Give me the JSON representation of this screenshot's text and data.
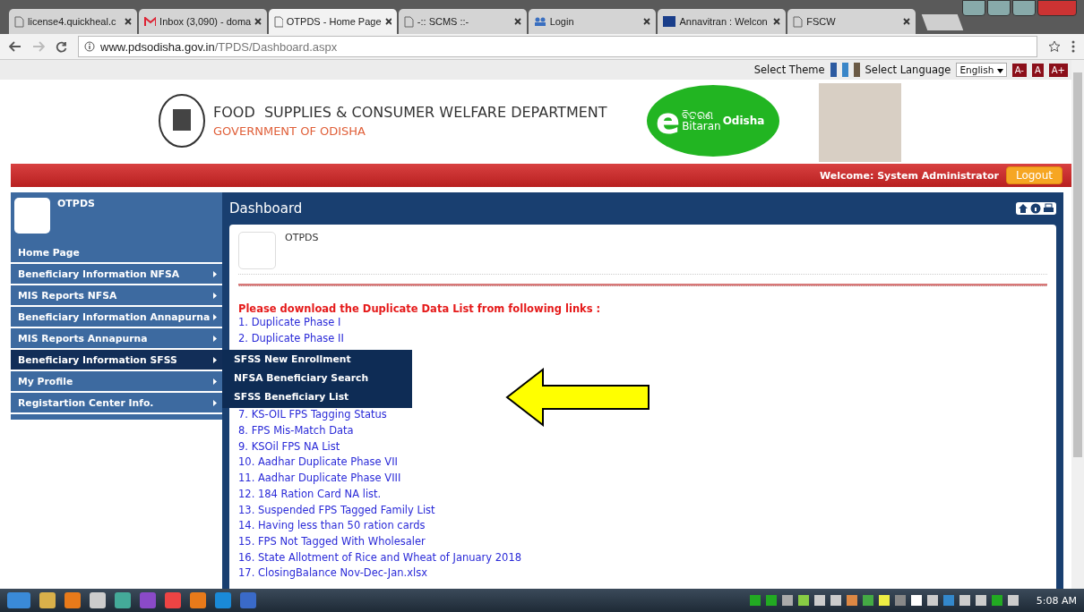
{
  "browser": {
    "tabs": [
      {
        "title": "license4.quickheal.c",
        "selected": false,
        "kind": "page"
      },
      {
        "title": "Inbox (3,090) - doma",
        "selected": false,
        "kind": "mail"
      },
      {
        "title": "OTPDS - Home Page",
        "selected": true,
        "kind": "page"
      },
      {
        "title": "-:: SCMS ::-",
        "selected": false,
        "kind": "page"
      },
      {
        "title": "Login",
        "selected": false,
        "kind": "site"
      },
      {
        "title": "Annavitran : Welcon",
        "selected": false,
        "kind": "nic"
      },
      {
        "title": "FSCW",
        "selected": false,
        "kind": "page"
      }
    ],
    "address": {
      "host": "www.pdsodisha.gov.in",
      "path": "/TPDS/Dashboard.aspx"
    }
  },
  "topbar": {
    "theme_label": "Select Theme",
    "theme_swatches": [
      {
        "color": "#2c5aa0"
      },
      {
        "color": "#3a86c8"
      },
      {
        "color": "#6b5a45"
      }
    ],
    "language_label": "Select Language",
    "language_value": "English",
    "font_buttons": [
      "A-",
      "A",
      "A+"
    ]
  },
  "header": {
    "department": "FOOD  SUPPLIES & CONSUMER WELFARE DEPARTMENT",
    "government": "GOVERNMENT OF ODISHA",
    "logo": {
      "e": "e",
      "odia": "ବିତରଣ",
      "bitaran": "Bitaran",
      "odisha": "Odisha"
    }
  },
  "redbar": {
    "welcome": "Welcome:  System Administrator",
    "logout": "Logout"
  },
  "sidebar": {
    "title": "OTPDS",
    "items": [
      {
        "label": "Home Page",
        "has_submenu": false,
        "selected": false
      },
      {
        "label": "Beneficiary Information NFSA",
        "has_submenu": true,
        "selected": false
      },
      {
        "label": "MIS Reports NFSA",
        "has_submenu": true,
        "selected": false
      },
      {
        "label": "Beneficiary Information Annapurna",
        "has_submenu": true,
        "selected": false
      },
      {
        "label": "MIS Reports Annapurna",
        "has_submenu": true,
        "selected": false
      },
      {
        "label": "Beneficiary Information SFSS",
        "has_submenu": true,
        "selected": true,
        "submenu": [
          "SFSS New Enrollment",
          "NFSA Beneficiary Search",
          "SFSS Beneficiary List"
        ]
      },
      {
        "label": "My Profile",
        "has_submenu": true,
        "selected": false
      },
      {
        "label": "Registartion Center Info.",
        "has_submenu": true,
        "selected": false
      }
    ]
  },
  "dashboard": {
    "title": "Dashboard",
    "card_title": "OTPDS",
    "notice": "Please download the Duplicate Data List from following links :",
    "links_before": [
      "1. Duplicate Phase I",
      "2. Duplicate Phase II"
    ],
    "links_after": [
      "7. KS-OIL FPS Tagging Status",
      "8. FPS Mis-Match Data",
      "9. KSOil FPS NA List",
      "10. Aadhar Duplicate Phase VII",
      "11. Aadhar Duplicate Phase VIII",
      "12. 184 Ration Card NA list.",
      "13. Suspended FPS Tagged Family List",
      "14. Having less than 50 ration cards",
      "15. FPS Not Tagged With Wholesaler",
      "16. State Allotment of Rice and Wheat of January 2018",
      "17. ClosingBalance Nov-Dec-Jan.xlsx"
    ]
  },
  "taskbar": {
    "time": "5:08 AM"
  }
}
